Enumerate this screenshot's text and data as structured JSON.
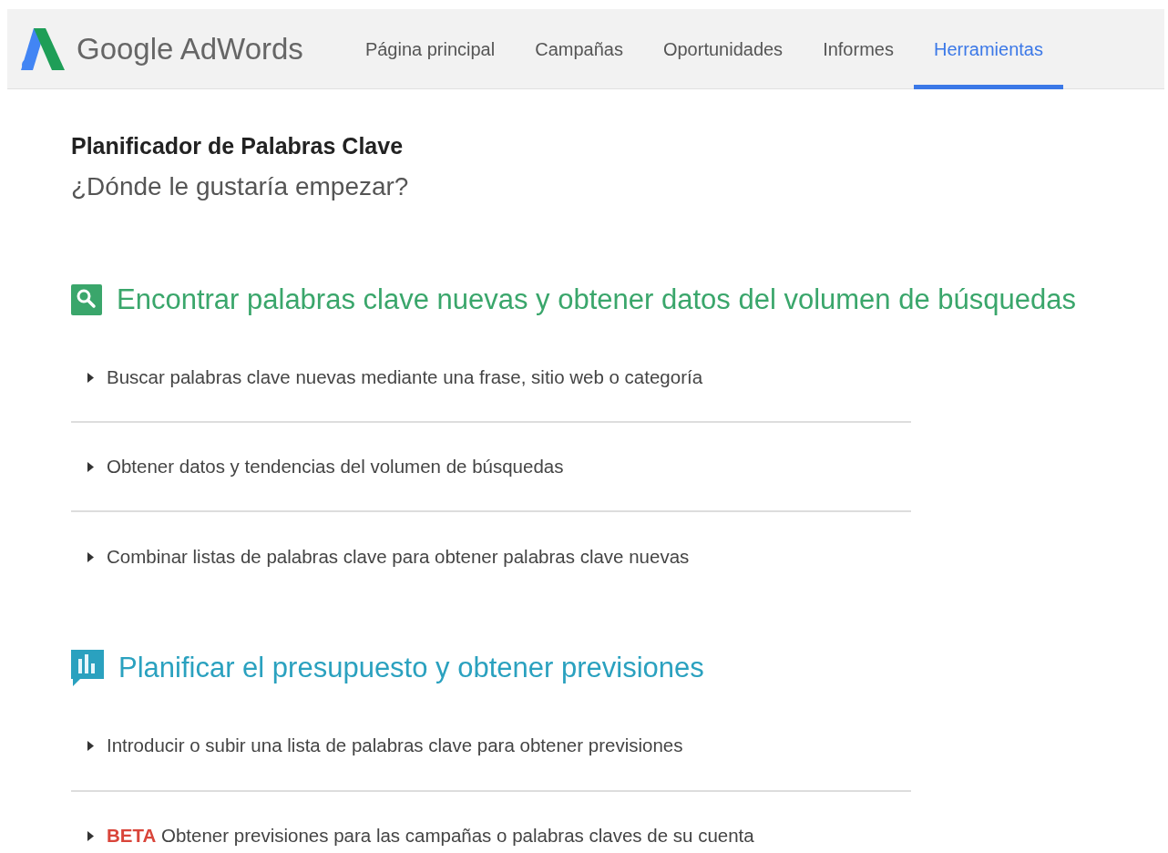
{
  "header": {
    "logo_text": "Google AdWords",
    "nav": [
      {
        "label": "Página principal",
        "selected": false
      },
      {
        "label": "Campañas",
        "selected": false
      },
      {
        "label": "Oportunidades",
        "selected": false
      },
      {
        "label": "Informes",
        "selected": false
      },
      {
        "label": "Herramientas",
        "selected": true
      }
    ]
  },
  "page": {
    "title": "Planificador de Palabras Clave",
    "subtitle": "¿Dónde le gustaría empezar?"
  },
  "sections": [
    {
      "kind": "search",
      "heading": "Encontrar palabras clave nuevas y obtener datos del volumen de búsquedas",
      "items": [
        {
          "text": "Buscar palabras clave nuevas mediante una frase, sitio web o categoría"
        },
        {
          "text": "Obtener datos y tendencias del volumen de búsquedas"
        },
        {
          "text": "Combinar listas de palabras clave para obtener palabras clave nuevas"
        }
      ]
    },
    {
      "kind": "forecast",
      "heading": "Planificar el presupuesto y obtener previsiones",
      "items": [
        {
          "text": "Introducir o subir una lista de palabras clave para obtener previsiones"
        },
        {
          "badge": "BETA",
          "text": "Obtener previsiones para las campañas o palabras claves de su cuenta"
        }
      ]
    }
  ]
}
